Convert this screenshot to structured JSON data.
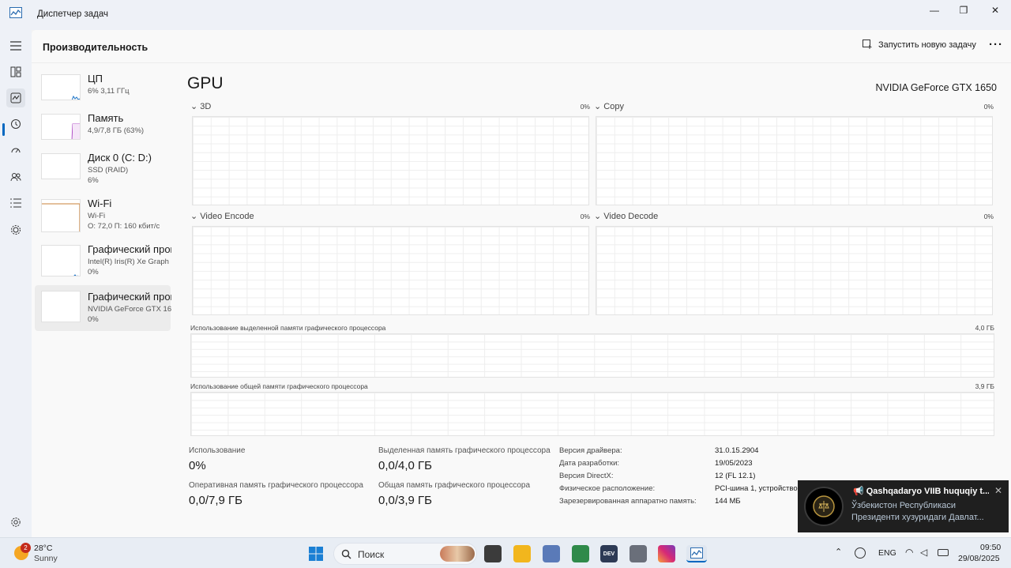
{
  "window": {
    "title": "Диспетчер задач",
    "minimize_glyph": "—",
    "restore_glyph": "❐",
    "close_glyph": "✕"
  },
  "header": {
    "title": "Производительность",
    "run_task_label": "Запустить новую задачу",
    "more_glyph": "···"
  },
  "devices": [
    {
      "name": "ЦП",
      "line1": "6% 3,11 ГГц",
      "line2": ""
    },
    {
      "name": "Память",
      "line1": "4,9/7,8 ГБ (63%)",
      "line2": ""
    },
    {
      "name": "Диск 0 (C: D:)",
      "line1": "SSD (RAID)",
      "line2": "6%"
    },
    {
      "name": "Wi-Fi",
      "line1": "Wi-Fi",
      "line2": "О: 72,0 П: 160 кбит/с"
    },
    {
      "name": "Графический проц",
      "line1": "Intel(R) Iris(R) Xe Graph",
      "line2": "0%"
    },
    {
      "name": "Графический проц",
      "line1": "NVIDIA GeForce GTX 16",
      "line2": "0%"
    }
  ],
  "gpu": {
    "heading": "GPU",
    "model": "NVIDIA GeForce GTX 1650",
    "engines": [
      {
        "label": "3D",
        "pct": "0%"
      },
      {
        "label": "Copy",
        "pct": "0%"
      },
      {
        "label": "Video Encode",
        "pct": "0%"
      },
      {
        "label": "Video Decode",
        "pct": "0%"
      }
    ],
    "chevron": "⌄",
    "dedicated_label": "Использование выделенной памяти графического процессора",
    "dedicated_max": "4,0 ГБ",
    "shared_label": "Использование общей памяти графического процессора",
    "shared_max": "3,9 ГБ"
  },
  "stats": {
    "usage_label": "Использование",
    "usage_value": "0%",
    "dedicated_label": "Выделенная память графического процессора",
    "dedicated_value": "0,0/4,0 ГБ",
    "gpu_ram_label": "Оперативная память графического процессора",
    "gpu_ram_value": "0,0/7,9 ГБ",
    "shared_label": "Общая память графического процессора",
    "shared_value": "0,0/3,9 ГБ"
  },
  "info": [
    {
      "key": "Версия драйвера:",
      "value": "31.0.15.2904"
    },
    {
      "key": "Дата разработки:",
      "value": "19/05/2023"
    },
    {
      "key": "Версия DirectX:",
      "value": "12 (FL 12.1)"
    },
    {
      "key": "Физическое расположение:",
      "value": "PCI-шина 1, устройство"
    },
    {
      "key": "Зарезервированная аппаратно память:",
      "value": "144 МБ"
    }
  ],
  "toast": {
    "title": "📢 Qashqadaryo VIIB huquqiy t...",
    "body": "Ўзбекистон Республикаси Президенти хузуридаги Давлат...",
    "close": "✕"
  },
  "taskbar": {
    "weather_temp": "28°C",
    "weather_cond": "Sunny",
    "weather_badge": "2",
    "search_placeholder": "Поиск",
    "lang": "ENG",
    "time": "09:50",
    "date": "29/08/2025"
  },
  "colors": {
    "accent": "#0067c0",
    "memory_line": "#b04fc6",
    "wifi_line": "#c9813a",
    "cpu_line": "#1a73c7"
  }
}
